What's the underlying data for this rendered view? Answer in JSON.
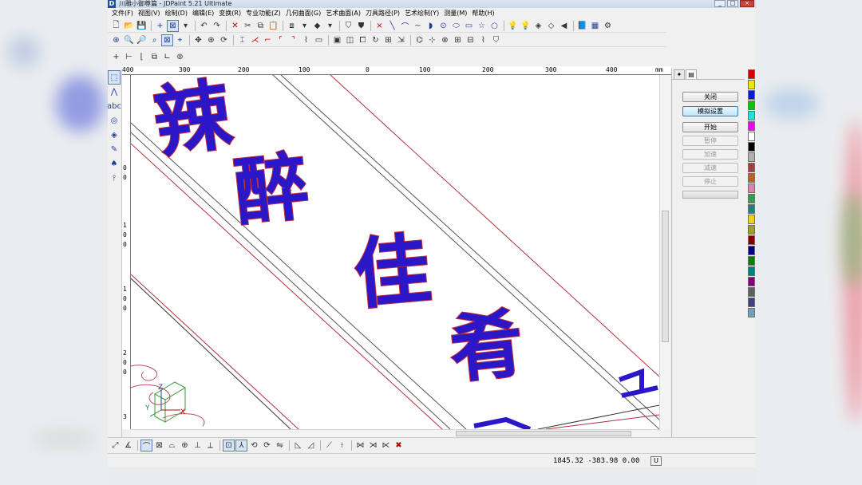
{
  "window": {
    "title": "川雕小御尊篇 - JDPaint 5.21 Ultimate",
    "app_icon_letter": "D",
    "controls": [
      "_",
      "□",
      "×"
    ]
  },
  "menu": [
    "文件(F)",
    "视图(V)",
    "绘制(D)",
    "编辑(E)",
    "变换(R)",
    "专业功能(Z)",
    "几何曲面(G)",
    "艺术曲面(A)",
    "刀具路径(P)",
    "艺术绘制(Y)",
    "测量(M)",
    "帮助(H)"
  ],
  "ruler": {
    "top": [
      "400",
      "300",
      "200",
      "100",
      "0",
      "100",
      "200",
      "300",
      "400",
      "mm"
    ],
    "left": [
      "0",
      "0",
      "1",
      "0",
      "0",
      "1",
      "0",
      "0",
      "2",
      "0",
      "0",
      "3"
    ]
  },
  "right_panel": {
    "buttons": [
      {
        "label": "关闭",
        "enabled": true
      },
      {
        "label": "模拟设置",
        "enabled": true
      },
      {
        "label": "开始",
        "enabled": true
      },
      {
        "label": "暂停",
        "enabled": false
      },
      {
        "label": "加速",
        "enabled": false
      },
      {
        "label": "减速",
        "enabled": false
      },
      {
        "label": "停止",
        "enabled": false
      }
    ]
  },
  "palette": [
    "#d40000",
    "#f5e500",
    "#0020d0",
    "#10c010",
    "#20e0e0",
    "#e010e0",
    "#ffffff",
    "#000000",
    "#b0b0b0",
    "#a04040",
    "#c06020",
    "#e080b0",
    "#30a050",
    "#208080",
    "#f0d020",
    "#a0a020",
    "#800000",
    "#000080",
    "#008000",
    "#008080",
    "#800080",
    "#606060",
    "#404080",
    "#70a0c0"
  ],
  "artwork": {
    "characters": [
      "辣",
      "醉",
      "佳",
      "肴"
    ],
    "fill_color": "#2b16c8",
    "outline_color": "#c0303a"
  },
  "status": {
    "coordinates": "1845.32  -383.98  0.00",
    "unit": "U"
  }
}
